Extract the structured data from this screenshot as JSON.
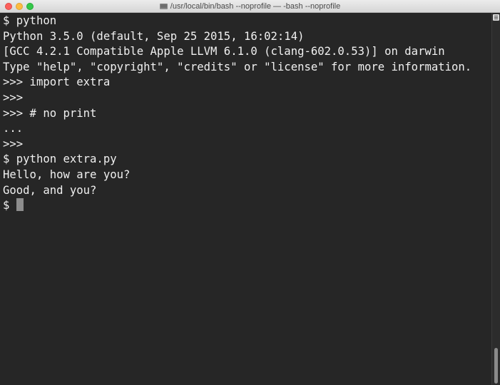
{
  "window": {
    "title": "/usr/local/bin/bash --noprofile — -bash --noprofile"
  },
  "terminal": {
    "lines": [
      "$ python",
      "Python 3.5.0 (default, Sep 25 2015, 16:02:14)",
      "[GCC 4.2.1 Compatible Apple LLVM 6.1.0 (clang-602.0.53)] on darwin",
      "Type \"help\", \"copyright\", \"credits\" or \"license\" for more information.",
      ">>> import extra",
      ">>>",
      ">>> # no print",
      "...",
      ">>>",
      "$ python extra.py",
      "Hello, how are you?",
      "Good, and you?"
    ],
    "prompt": "$ "
  },
  "colors": {
    "background": "#262626",
    "text": "#f0f0f0",
    "cursor": "#8d8d8d"
  }
}
